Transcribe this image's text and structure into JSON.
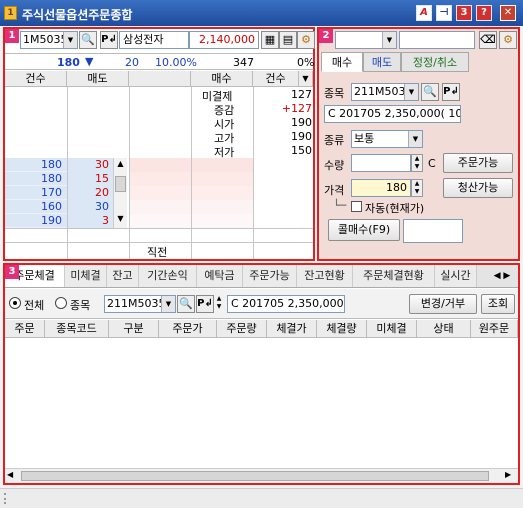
{
  "window": {
    "title": "주식선물옵션주문종합",
    "app_icon": "1",
    "tb_a": "A",
    "tb_3": "3",
    "tb_help": "?",
    "tb_close": "✕"
  },
  "p1": {
    "badge": "1",
    "code": "1M5035",
    "name": "삼성전자",
    "price_box": "2,140,000",
    "info_price": "180",
    "info_arrow": "▼",
    "info_change": "20",
    "info_pct": "10.00%",
    "info_vol": "347",
    "info_zero": "0%",
    "hdr": [
      "건수",
      "매도",
      "",
      "매수",
      "건수"
    ],
    "stats": [
      {
        "label": "미결제",
        "value": "127",
        "color": "#000000"
      },
      {
        "label": "증감",
        "value": "+127",
        "color": "#d00000"
      },
      {
        "label": "시가",
        "value": "190",
        "color": "#000000"
      },
      {
        "label": "고가",
        "value": "190",
        "color": "#000000"
      },
      {
        "label": "저가",
        "value": "150",
        "color": "#000000"
      }
    ],
    "depth": [
      {
        "price": "180",
        "qty": "30",
        "qcolor": "#d00000"
      },
      {
        "price": "180",
        "qty": "15",
        "qcolor": "#d00000"
      },
      {
        "price": "170",
        "qty": "20",
        "qcolor": "#d00000"
      },
      {
        "price": "160",
        "qty": "30",
        "qcolor": "#1a3fbf"
      },
      {
        "price": "190",
        "qty": "3",
        "qcolor": "#d00000"
      }
    ],
    "bottom_label": "직전"
  },
  "p2": {
    "badge": "2",
    "tabs": [
      "매수",
      "매도",
      "정정/취소"
    ],
    "code_label": "종목",
    "code": "211M5035",
    "desc": "C 201705 2,350,000(  10)",
    "type_label": "종류",
    "type_value": "보통",
    "qty_label": "수량",
    "qty_unit": "C",
    "order_avail": "주문가능",
    "price_label": "가격",
    "price_value": "180",
    "settle_avail": "청산가능",
    "auto_label": "자동(현재가)",
    "buy_btn": "콜매수(F9)"
  },
  "p3": {
    "badge": "3",
    "tabs": [
      "주문체결",
      "미체결",
      "잔고",
      "기간손익",
      "예탁금",
      "주문가능",
      "잔고현황",
      "주문체결현황",
      "실시간"
    ],
    "radio_all": "전체",
    "radio_item": "종목",
    "code": "211M5035",
    "desc": "C 201705 2,350,000",
    "modify_btn": "변경/거부",
    "query_btn": "조회",
    "cols": [
      "주문",
      "종목코드",
      "구분",
      "주문가",
      "주문량",
      "체결가",
      "체결량",
      "미체결",
      "상태",
      "원주문"
    ]
  }
}
